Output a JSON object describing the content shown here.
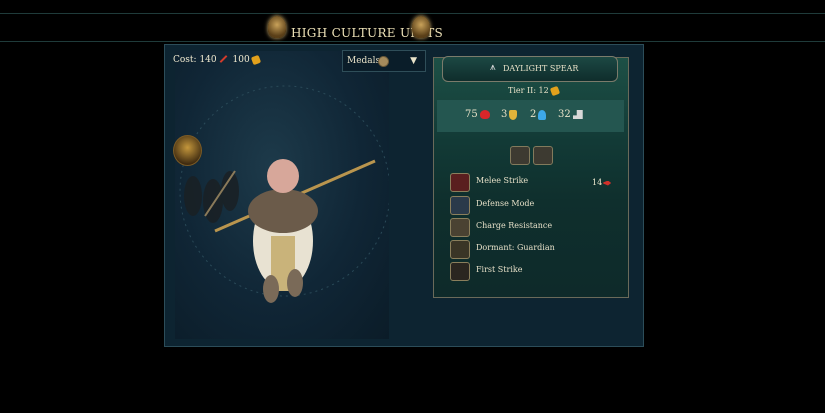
{
  "header": {
    "title": "HIGH CULTURE UNITS"
  },
  "cost": {
    "prefix": "Cost:",
    "production": "140",
    "gold": "100"
  },
  "medals": {
    "label": "Medals",
    "arrow": "▼"
  },
  "unit": {
    "name": "DAYLIGHT SPEAR",
    "tier": "Tier II: 12",
    "stats": {
      "health": "75",
      "defense": "3",
      "mana": "2",
      "movement": "32"
    }
  },
  "abilities": [
    {
      "label": "Melee Strike",
      "icon": "sword-slash-icon"
    },
    {
      "label": "Defense Mode",
      "icon": "shield-icon"
    },
    {
      "label": "Charge Resistance",
      "icon": "chevrons-icon"
    },
    {
      "label": "Dormant: Guardian",
      "icon": "guardian-icon"
    },
    {
      "label": "First Strike",
      "icon": "first-strike-icon"
    }
  ],
  "damage": {
    "value": "14"
  },
  "colors": {
    "panel": "#0d2431",
    "card": "#1d5046",
    "accent": "#e2a11c",
    "health": "#d9262a"
  }
}
